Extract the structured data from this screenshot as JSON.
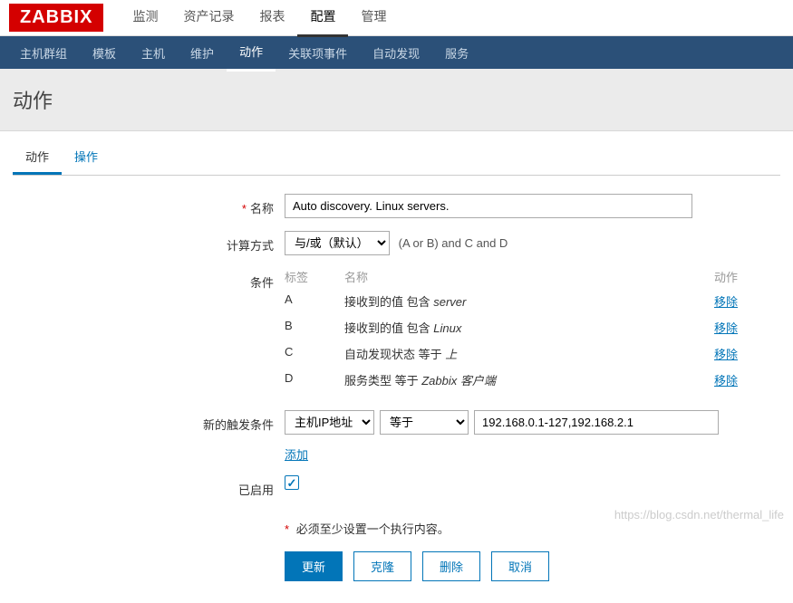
{
  "logo": "ZABBIX",
  "topmenu": {
    "items": [
      "监测",
      "资产记录",
      "报表",
      "配置",
      "管理"
    ],
    "active": 3
  },
  "submenu": {
    "items": [
      "主机群组",
      "模板",
      "主机",
      "维护",
      "动作",
      "关联项事件",
      "自动发现",
      "服务"
    ],
    "active": 4
  },
  "page_title": "动作",
  "tabs": {
    "items": [
      "动作",
      "操作"
    ],
    "active": 0
  },
  "form": {
    "name_label": "名称",
    "name_value": "Auto discovery. Linux servers.",
    "calc_label": "计算方式",
    "calc_options": [
      "与/或（默认）"
    ],
    "calc_hint": "(A or B) and C and D",
    "cond_label": "条件",
    "cond_headers": {
      "label": "标签",
      "name": "名称",
      "action": "动作"
    },
    "conditions": [
      {
        "l": "A",
        "prefix": "接收到的值 包含 ",
        "val": "server"
      },
      {
        "l": "B",
        "prefix": "接收到的值 包含 ",
        "val": "Linux"
      },
      {
        "l": "C",
        "prefix": "自动发现状态 等于 ",
        "val": "上"
      },
      {
        "l": "D",
        "prefix": "服务类型 等于 ",
        "val": "Zabbix 客户端"
      }
    ],
    "remove_label": "移除",
    "newtrig_label": "新的触发条件",
    "newtrig_type_options": [
      "主机IP地址"
    ],
    "newtrig_op_options": [
      "等于"
    ],
    "newtrig_value": "192.168.0.1-127,192.168.2.1",
    "add_label": "添加",
    "enabled_label": "已启用",
    "warn_text": "必须至少设置一个执行内容。",
    "buttons": {
      "update": "更新",
      "clone": "克隆",
      "delete": "删除",
      "cancel": "取消"
    }
  },
  "watermark": "https://blog.csdn.net/thermal_life"
}
